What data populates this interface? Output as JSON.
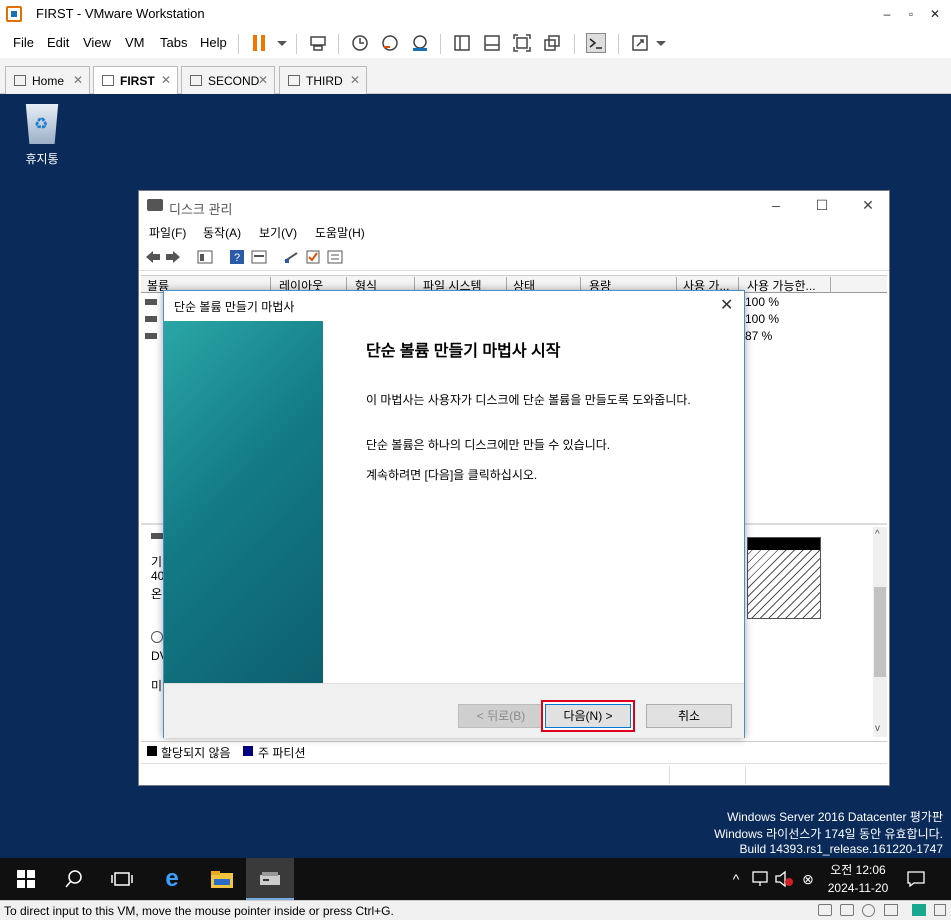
{
  "window": {
    "title": "FIRST - VMware Workstation",
    "minimize": "–",
    "maximize": "▫",
    "close": "✕"
  },
  "menu": {
    "file": "File",
    "edit": "Edit",
    "view": "View",
    "vm": "VM",
    "tabs": "Tabs",
    "help": "Help"
  },
  "tabs": [
    {
      "label": "Home",
      "close": "✕"
    },
    {
      "label": "FIRST",
      "close": "✕"
    },
    {
      "label": "SECOND",
      "close": "✕"
    },
    {
      "label": "THIRD",
      "close": "✕"
    }
  ],
  "desktop": {
    "recycle_bin_label": "휴지통",
    "watermark": [
      "Windows Server 2016 Datacenter 평가판",
      "Windows 라이선스가 174일 동안 유효합니다.",
      "Build 14393.rs1_release.161220-1747"
    ]
  },
  "disk_mgmt": {
    "title": "디스크 관리",
    "menus": [
      "파일(F)",
      "동작(A)",
      "보기(V)",
      "도움말(H)"
    ],
    "columns": [
      "볼륨",
      "레이아웃",
      "형식",
      "파일 시스템",
      "상태",
      "용량",
      "사용 가...",
      "사용 가능한..."
    ],
    "free_pct": [
      "100 %",
      "100 %",
      "87 %"
    ],
    "lower_fragments": [
      "기",
      "40",
      "온",
      "DV",
      "미"
    ],
    "legend": [
      "할당되지 않음",
      "주 파티션"
    ],
    "legend_colors": {
      "unallocated": "#000000",
      "primary": "#000080"
    }
  },
  "wizard": {
    "title": "단순 볼륨 만들기 마법사",
    "close": "✕",
    "heading": "단순 볼륨 만들기 마법사 시작",
    "para1": "이 마법사는 사용자가 디스크에 단순 볼륨을 만들도록 도와줍니다.",
    "para2": "단순 볼륨은 하나의 디스크에만 만들 수 있습니다.",
    "para3": "계속하려면 [다음]을 클릭하십시오.",
    "back_button": "< 뒤로(B)",
    "next_button": "다음(N) >",
    "cancel_button": "취소",
    "highlight_color": "#e0001a"
  },
  "taskbar": {
    "time": "오전 12:06",
    "date": "2024-11-20"
  },
  "status": {
    "message": "To direct input to this VM, move the mouse pointer inside or press Ctrl+G."
  }
}
